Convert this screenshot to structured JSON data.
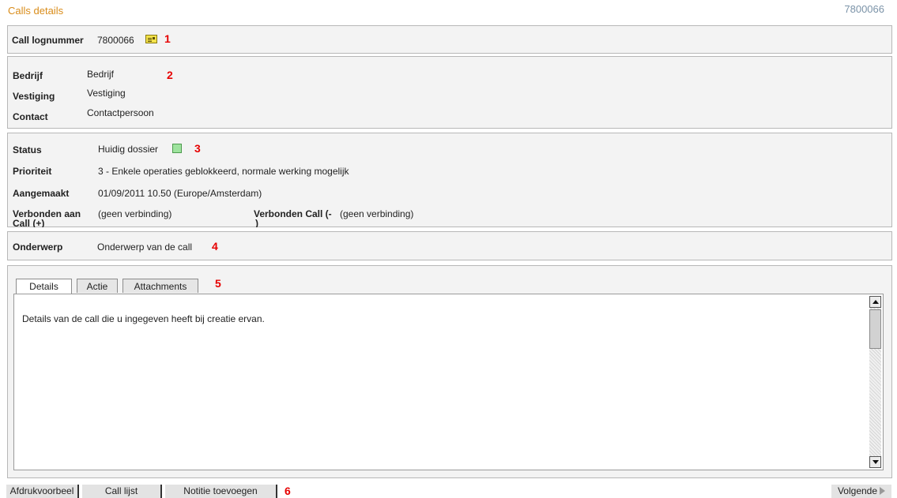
{
  "header": {
    "breadcrumb": "Calls details",
    "call_number": "7800066"
  },
  "lognummer": {
    "label": "Call lognummer",
    "value": "7800066",
    "marker": "1",
    "icon": "envelope-icon"
  },
  "company": {
    "marker": "2",
    "rows": [
      {
        "label": "Bedrijf",
        "value": "Bedrijf"
      },
      {
        "label": "Vestiging",
        "value": "Vestiging"
      },
      {
        "label": "Contact",
        "value": "Contactpersoon"
      }
    ]
  },
  "status": {
    "marker": "3",
    "status_label": "Status",
    "status_value": "Huidig dossier",
    "status_color": "#9ee39e",
    "priority_label": "Prioriteit",
    "priority_value": "3 - Enkele operaties geblokkeerd, normale werking mogelijk",
    "created_label": "Aangemaakt",
    "created_value": "01/09/2011 10.50 (Europe/Amsterdam)",
    "linked_plus_label_1": "Verbonden aan",
    "linked_plus_label_2": "Call (+)",
    "linked_plus_value": "(geen verbinding)",
    "linked_minus_label_1": "Verbonden Call (-",
    "linked_minus_label_2": ")",
    "linked_minus_value": "(geen verbinding)"
  },
  "subject": {
    "label": "Onderwerp",
    "value": "Onderwerp van de call",
    "marker": "4"
  },
  "tabs": {
    "marker": "5",
    "items": [
      {
        "label": "Details",
        "active": true
      },
      {
        "label": "Actie",
        "active": false
      },
      {
        "label": "Attachments",
        "active": false
      }
    ],
    "content": "Details van de call die u ingegeven heeft bij creatie ervan."
  },
  "footer": {
    "buttons": [
      "Afdrukvoorbeel",
      "Call lijst",
      "Notitie toevoegen"
    ],
    "marker": "6",
    "next_label": "Volgende"
  }
}
